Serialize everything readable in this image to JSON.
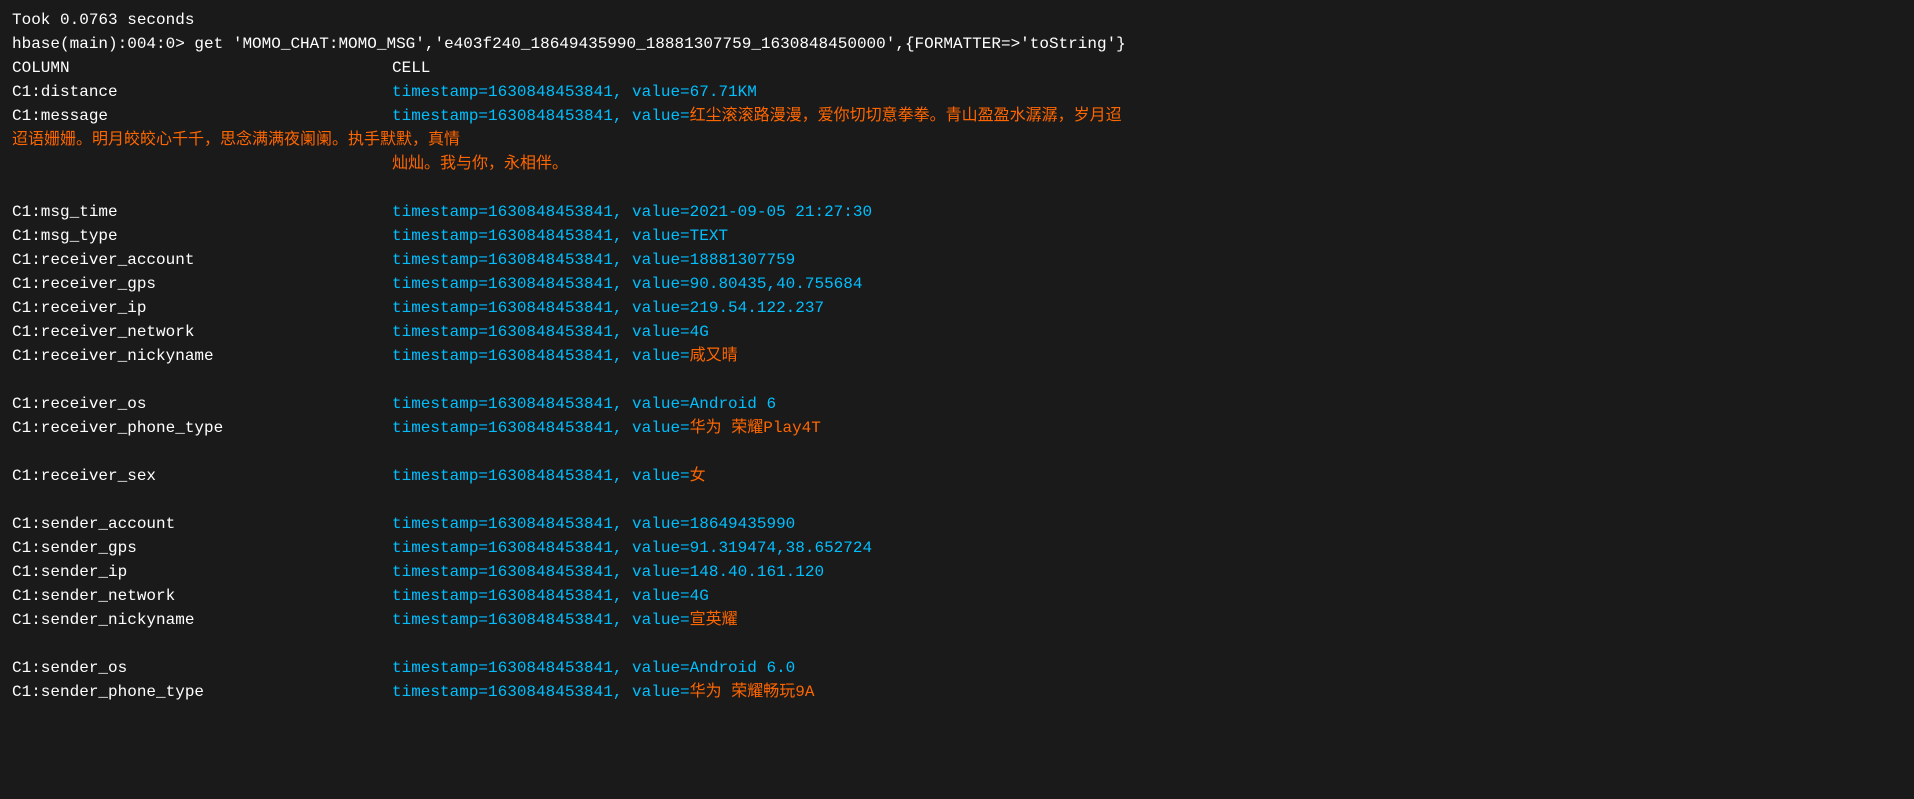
{
  "terminal": {
    "line1": "Took 0.0763 seconds",
    "line2": "hbase(main):004:0> get 'MOMO_CHAT:MOMO_MSG','e403f240_18649435990_18881307759_1630848450000',{FORMATTER=>'toString'}",
    "headers": {
      "column": "COLUMN",
      "cell": "CELL"
    },
    "rows": [
      {
        "column": "C1:distance",
        "cell": "timestamp=1630848453841, value=67.71KM"
      },
      {
        "column": "C1:message",
        "cell": "timestamp=1630848453841, value=红尘滚滚路漫漫，爱你切切意拳拳。青山盈盈水潺潺，岁月迢",
        "continuation": true,
        "continuation_lines": [
          "迢语姗姗。明月皎皎心千千，思念满满夜阑阑。执手默默，真情",
          "                    灿灿。我与你，永相伴。"
        ]
      },
      {
        "column": "C1:msg_time",
        "cell": "timestamp=1630848453841, value=2021-09-05 21:27:30"
      },
      {
        "column": "C1:msg_type",
        "cell": "timestamp=1630848453841, value=TEXT"
      },
      {
        "column": "C1:receiver_account",
        "cell": "timestamp=1630848453841, value=18881307759"
      },
      {
        "column": "C1:receiver_gps",
        "cell": "timestamp=1630848453841, value=90.80435,40.755684"
      },
      {
        "column": "C1:receiver_ip",
        "cell": "timestamp=1630848453841, value=219.54.122.237"
      },
      {
        "column": "C1:receiver_network",
        "cell": "timestamp=1630848453841, value=4G"
      },
      {
        "column": "C1:receiver_nickyname",
        "cell": "timestamp=1630848453841, value=咸又晴"
      },
      {
        "column": "C1:receiver_os",
        "cell": "timestamp=1630848453841, value=Android 6"
      },
      {
        "column": "C1:receiver_phone_type",
        "cell": "timestamp=1630848453841, value=华为 荣耀Play4T"
      },
      {
        "column": "C1:receiver_sex",
        "cell": "timestamp=1630848453841, value=女"
      },
      {
        "column": "C1:sender_account",
        "cell": "timestamp=1630848453841, value=18649435990"
      },
      {
        "column": "C1:sender_gps",
        "cell": "timestamp=1630848453841, value=91.319474,38.652724"
      },
      {
        "column": "C1:sender_ip",
        "cell": "timestamp=1630848453841, value=148.40.161.120"
      },
      {
        "column": "C1:sender_network",
        "cell": "timestamp=1630848453841, value=4G"
      },
      {
        "column": "C1:sender_nickyname",
        "cell": "timestamp=1630848453841, value=宣英耀"
      },
      {
        "column": "C1:sender_os",
        "cell": "timestamp=1630848453841, value=Android 6.0"
      },
      {
        "column": "C1:sender_phone_type",
        "cell": "timestamp=1630848453841, value=华为 荣耀畅玩9A"
      }
    ],
    "blank_rows_after": {
      "after_message": true,
      "after_nickyname_receiver": true,
      "after_phone_type_receiver": true,
      "after_sex_receiver": true,
      "after_nickyname_sender": true
    }
  }
}
